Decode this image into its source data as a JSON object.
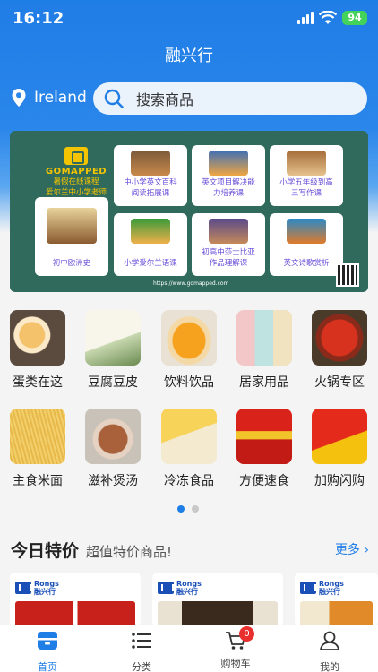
{
  "status": {
    "time": "16:12",
    "battery": "94"
  },
  "header": {
    "title": "融兴行",
    "location": "Ireland",
    "search_placeholder": "搜索商品"
  },
  "banner": {
    "brand_name": "GOMAPPED",
    "brand_line1": "暑假在线课程",
    "brand_line2": "爱尔兰中小学老师",
    "url": "https://www.gomapped.com",
    "courses": [
      "中小学英文百科\n阅读拓展课",
      "英文项目解决能\n力培养课",
      "小学五年级到高\n三写作课",
      "初中欧洲史",
      "小学爱尔兰语课",
      "初高中莎士比亚\n作品理解课",
      "英文诗歌赏析"
    ]
  },
  "categories": [
    "蛋类在这",
    "豆腐豆皮",
    "饮料饮品",
    "居家用品",
    "火锅专区",
    "主食米面",
    "滋补煲汤",
    "冷冻食品",
    "方便速食",
    "加购闪购"
  ],
  "special": {
    "title": "今日特价",
    "subtitle": "超值特价商品!",
    "more": "更多"
  },
  "products": [
    {
      "logo_line1": "Rongs",
      "logo_line2": "融兴行"
    },
    {
      "logo_line1": "Rongs",
      "logo_line2": "融兴行"
    },
    {
      "logo_line1": "Rongs",
      "logo_line2": "融兴行"
    }
  ],
  "tabbar": {
    "home": "首页",
    "category": "分类",
    "cart": "购物车",
    "cart_count": "0",
    "mine": "我的"
  },
  "colors": {
    "primary": "#1f7de6",
    "banner_bg": "#2f6a5c",
    "badge": "#e8312e"
  }
}
